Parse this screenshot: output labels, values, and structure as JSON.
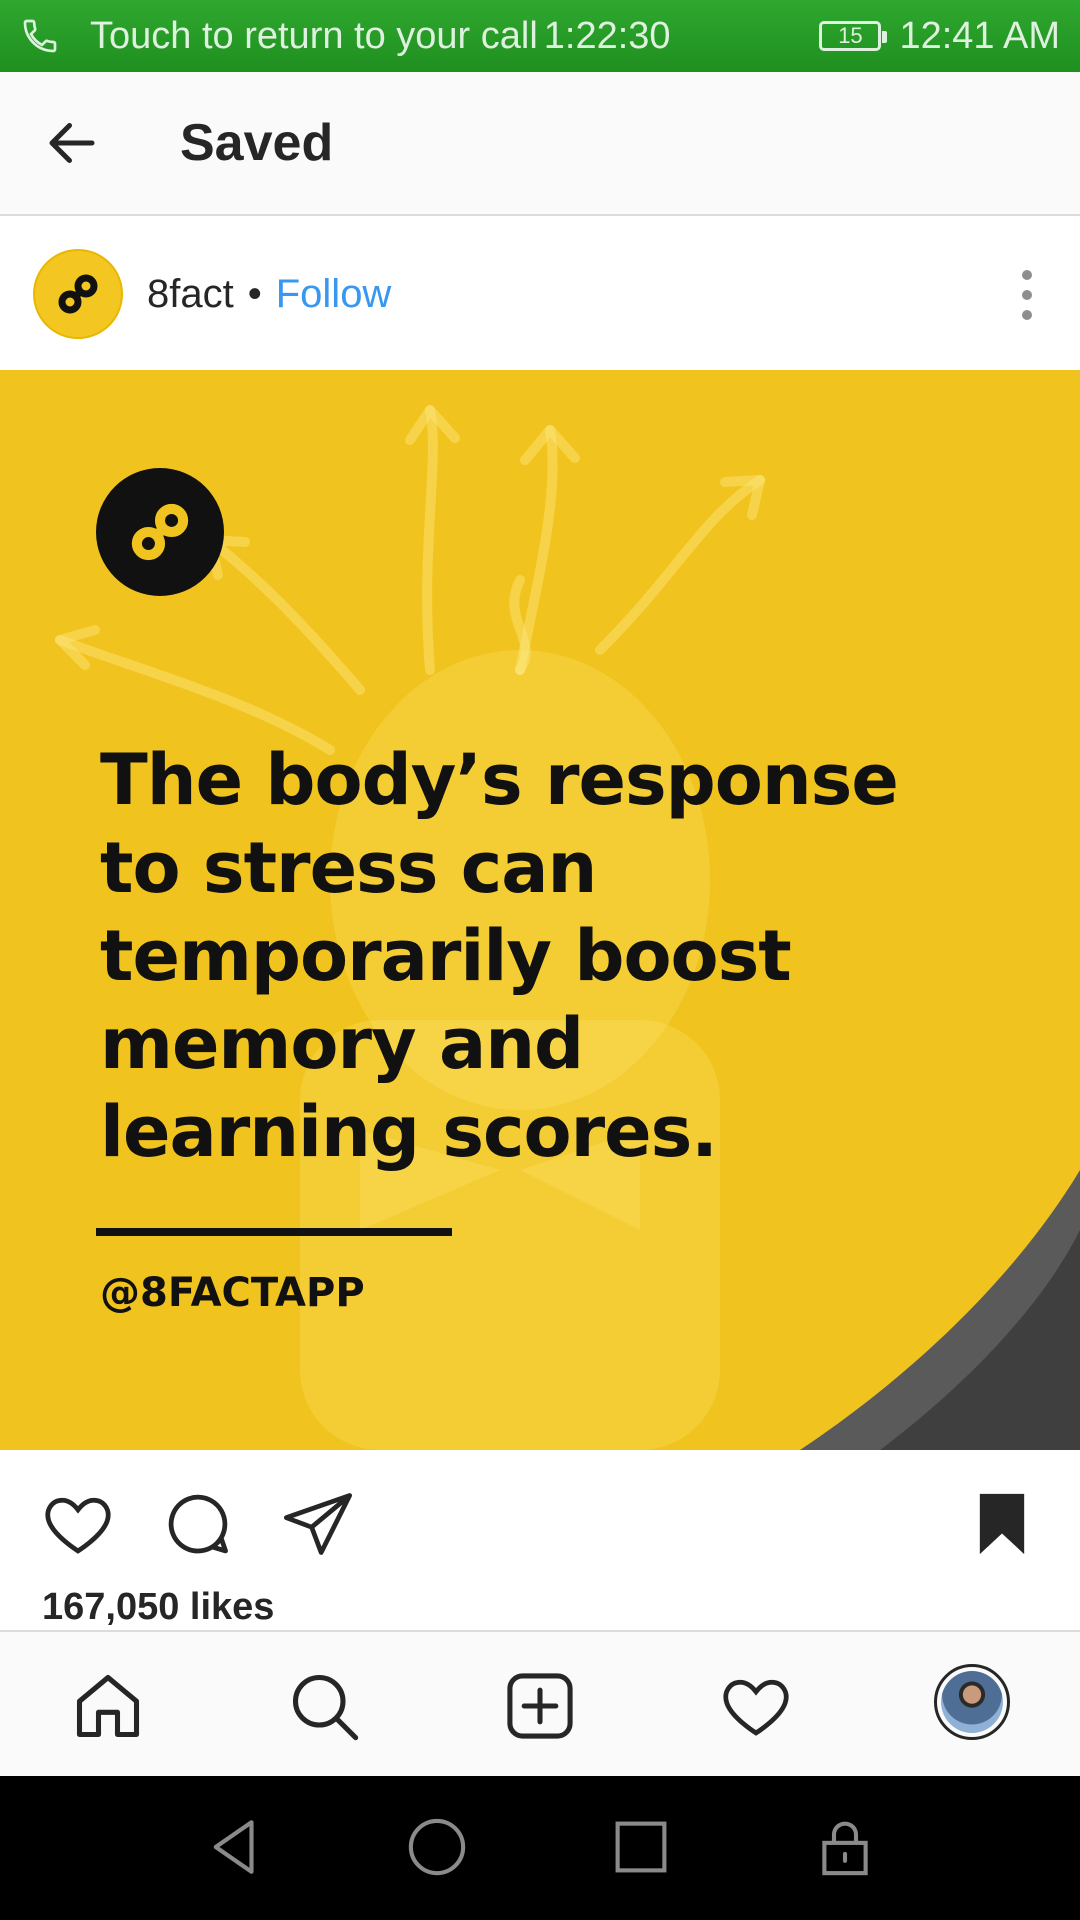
{
  "status_bar": {
    "call_text": "Touch to return to your call",
    "call_timer": "1:22:30",
    "battery_level": "15",
    "time": "12:41 AM",
    "icons": [
      "phone-icon",
      "battery-icon"
    ]
  },
  "header": {
    "title": "Saved",
    "back_icon": "arrow-left-icon"
  },
  "post": {
    "username": "8fact",
    "separator": "•",
    "follow_label": "Follow",
    "more_icon": "vertical-dots-icon",
    "image": {
      "fact_text": "The body’s response to stress can temporarily boost memory and learning scores.",
      "handle": "@8FACTAPP",
      "brand_color": "#f1c31f"
    },
    "likes": "167,050 likes",
    "actions": [
      "heart-icon",
      "comment-icon",
      "share-icon",
      "bookmark-icon"
    ]
  },
  "bottom_nav": {
    "items": [
      "home-icon",
      "search-icon",
      "add-post-icon",
      "activity-heart-icon",
      "profile-avatar"
    ]
  },
  "system_nav": {
    "items": [
      "back-triangle-icon",
      "home-circle-icon",
      "recents-square-icon",
      "lock-icon"
    ]
  },
  "colors": {
    "status_bar": "#1f8f1f",
    "link": "#3897f0",
    "text": "#262626"
  }
}
